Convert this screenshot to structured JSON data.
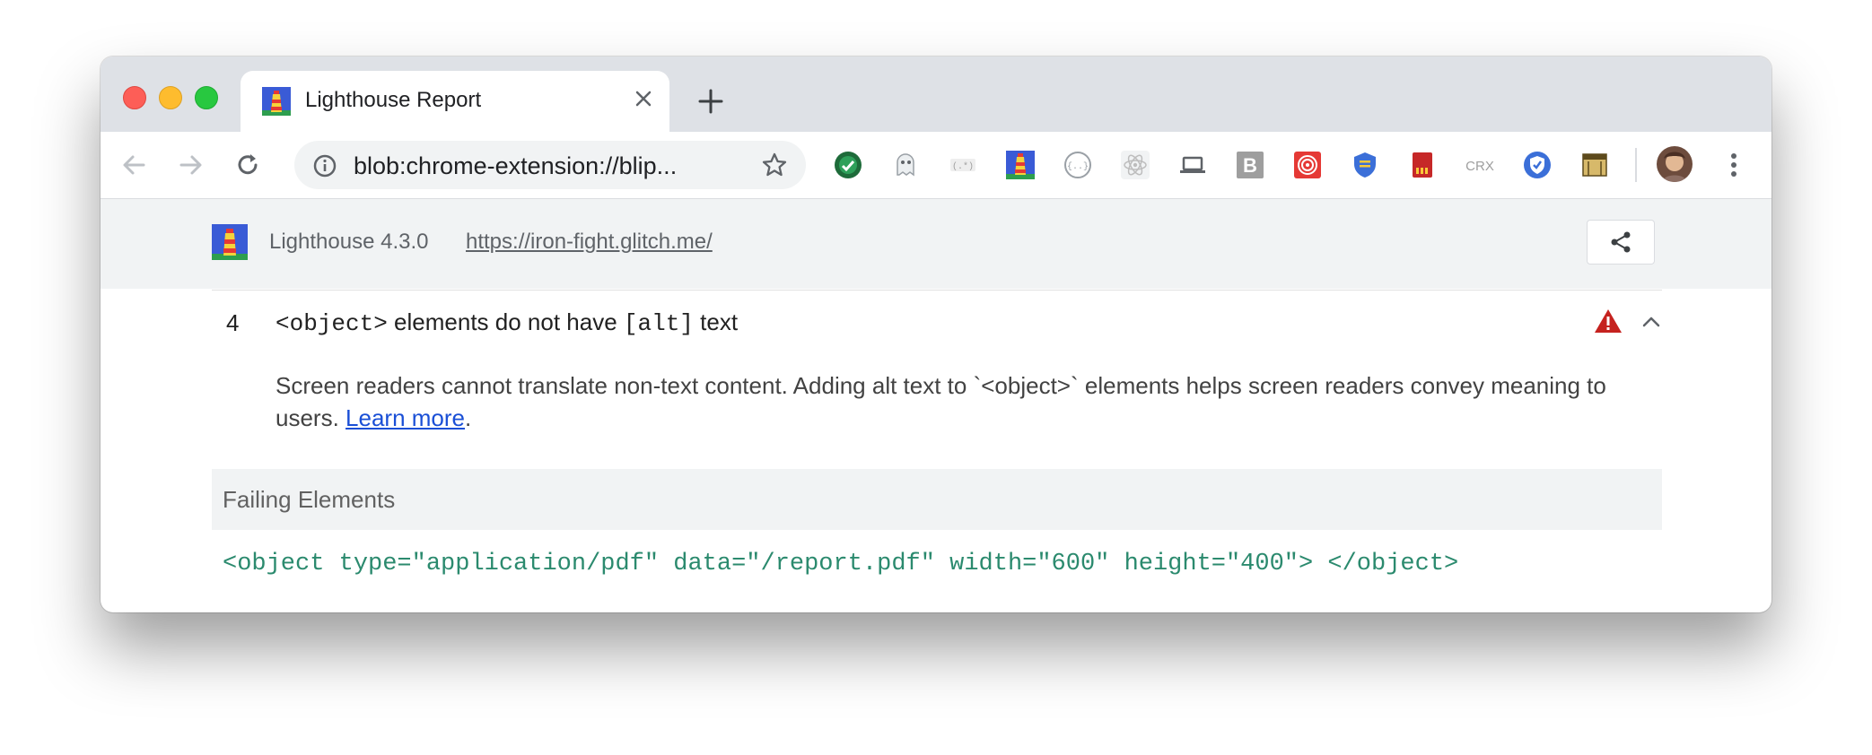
{
  "tab": {
    "title": "Lighthouse Report"
  },
  "omnibox": {
    "url": "blob:chrome-extension://blip..."
  },
  "extensions": [
    "check-icon",
    "ghost-icon",
    "regex-icon",
    "lighthouse-icon",
    "json-icon",
    "react-icon",
    "laptop-icon",
    "b-icon",
    "spiral-icon",
    "shield-icon",
    "sd-card-icon",
    "CRX",
    "vpn-shield-icon",
    "clapperboard-icon"
  ],
  "lighthouse": {
    "version": "Lighthouse 4.3.0",
    "url": "https://iron-fight.glitch.me/"
  },
  "audit": {
    "index": "4",
    "title_prefix": "<object>",
    "title_middle": " elements do not have ",
    "title_code": "[alt]",
    "title_suffix": " text",
    "description": "Screen readers cannot translate non-text content. Adding alt text to `<object>` elements helps screen readers convey meaning to users. ",
    "learn_more": "Learn more",
    "description_end": "."
  },
  "failing": {
    "header": "Failing Elements",
    "snippet": "<object type=\"application/pdf\" data=\"/report.pdf\" width=\"600\" height=\"400\"> </object>"
  },
  "colors": {
    "tabstrip": "#dee1e6",
    "lh_topbar": "#f1f3f4",
    "fail_red": "#c5221f",
    "snippet_green": "#2b8a6e",
    "link_blue": "#1a4fd6"
  }
}
